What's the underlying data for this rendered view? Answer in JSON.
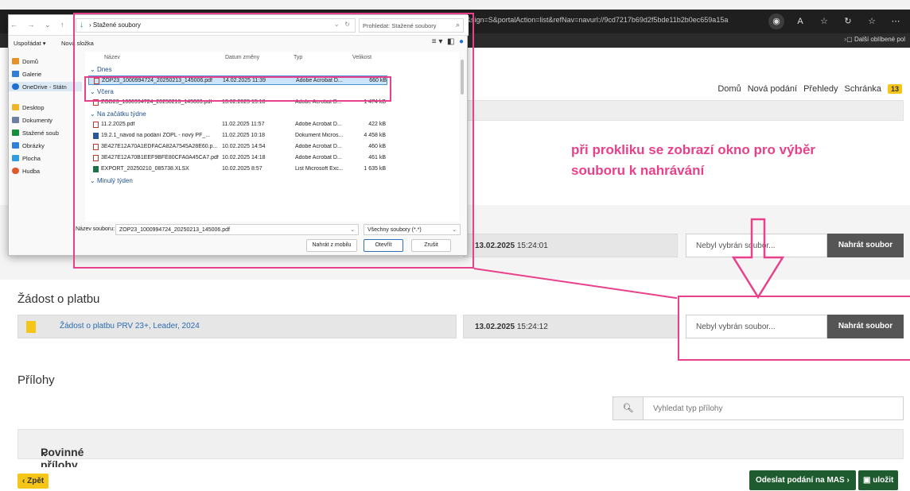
{
  "browser": {
    "url": "io D&sign=S&portalAction=list&refNav=navurl://9cd7217b69d2f5bde11b2b0ec659a15a",
    "favorites_label": "Další oblíbené pol",
    "icons": [
      "tracking-icon",
      "read-aloud-icon",
      "favorite-icon",
      "refresh-icon",
      "collections-icon",
      "more-icon"
    ]
  },
  "topnav": {
    "items": [
      "Domů",
      "Nová podání",
      "Přehledy",
      "Schránka"
    ],
    "inbox_count": "13"
  },
  "annotation": {
    "line1": "při prokliku se zobrazí okno pro výběr",
    "line2": "souboru k nahrávání"
  },
  "rows": [
    {
      "title": "",
      "date_bold": "13.02.2025",
      "time": "15:24:01",
      "file_placeholder": "Nebyl vybrán soubor...",
      "upload_label": "Nahrát soubor"
    },
    {
      "title": "Žádost o platbu",
      "doc_name": "Žádost o platbu PRV 23+, Leader, 2024",
      "date_bold": "13.02.2025",
      "time": "15:24:12",
      "file_placeholder": "Nebyl vybrán soubor...",
      "upload_label": "Nahrát soubor"
    }
  ],
  "attachments": {
    "title": "Přílohy",
    "search_placeholder": "Vyhledat typ přílohy",
    "required_label": "Povinné přílohy"
  },
  "footer": {
    "back_label": "Zpět",
    "submit_label": "Odeslat podání na MAS",
    "save_label": "uložit"
  },
  "dialog": {
    "path": "Stažené soubory",
    "search_placeholder": "Prohledat: Stažené soubory",
    "organize_label": "Uspořádat",
    "new_folder_label": "Nová složka",
    "nav": [
      {
        "label": "Domů",
        "color": "#e8902a"
      },
      {
        "label": "Galerie",
        "color": "#2f7fd6"
      },
      {
        "label": "OneDrive - Státn",
        "color": "#1e6fd1",
        "selected": true
      },
      {
        "label": "Desktop",
        "color": "#f0b429"
      },
      {
        "label": "Dokumenty",
        "color": "#6b7fa6"
      },
      {
        "label": "Stažené soub",
        "color": "#1a8f3a"
      },
      {
        "label": "Obrázky",
        "color": "#2f7fd6"
      },
      {
        "label": "Plocha",
        "color": "#2f9de0"
      },
      {
        "label": "Hudba",
        "color": "#e0592a"
      }
    ],
    "columns": [
      "Název",
      "Datum změny",
      "Typ",
      "Velikost"
    ],
    "groups": [
      {
        "label": "Dnes",
        "files": [
          {
            "name": "ZOP23_1000994724_20250213_145006.pdf",
            "date": "14.02.2025 11:39",
            "type": "Adobe Acrobat D...",
            "size": "660 kB",
            "kind": "pdf",
            "selected": true
          }
        ]
      },
      {
        "label": "Včera",
        "files": [
          {
            "name": "ZOD23_1000994724_20250213_145003.pdf",
            "date": "13.02.2025 15:18",
            "type": "Adobe Acrobat D...",
            "size": "1 474 kB",
            "kind": "pdf"
          }
        ]
      },
      {
        "label": "Na začátku týdne",
        "files": [
          {
            "name": "11.2.2025.pdf",
            "date": "11.02.2025 11:57",
            "type": "Adobe Acrobat D...",
            "size": "422 kB",
            "kind": "pdf"
          },
          {
            "name": "19.2.1_návod na podání ŽOPL - nový PF_...",
            "date": "11.02.2025 10:18",
            "type": "Dokument Micros...",
            "size": "4 458 kB",
            "kind": "word"
          },
          {
            "name": "3E427E12A70A1EDFACA82A7545A28E60.p...",
            "date": "10.02.2025 14:54",
            "type": "Adobe Acrobat D...",
            "size": "460 kB",
            "kind": "pdf"
          },
          {
            "name": "3E427E12A70B1EEF9BFE80CFA0A45CA7.pdf",
            "date": "10.02.2025 14:18",
            "type": "Adobe Acrobat D...",
            "size": "461 kB",
            "kind": "pdf"
          },
          {
            "name": "EXPORT_20250210_085738.XLSX",
            "date": "10.02.2025 8:57",
            "type": "List Microsoft Exc...",
            "size": "1 635 kB",
            "kind": "xls"
          }
        ]
      },
      {
        "label": "Minulý týden",
        "files": []
      }
    ],
    "filename_label": "Název souboru:",
    "filename_value": "ZOP23_1000994724_20250213_145006.pdf",
    "filter_value": "Všechny soubory (*.*)",
    "mobile_button": "Nahrát z mobilu",
    "open_button": "Otevřít",
    "cancel_button": "Zrušit"
  },
  "colors": {
    "accent_yellow": "#f5c518",
    "submit_green": "#1e5b2e",
    "highlight_pink": "#e8408a",
    "upload_gray": "#555555"
  }
}
